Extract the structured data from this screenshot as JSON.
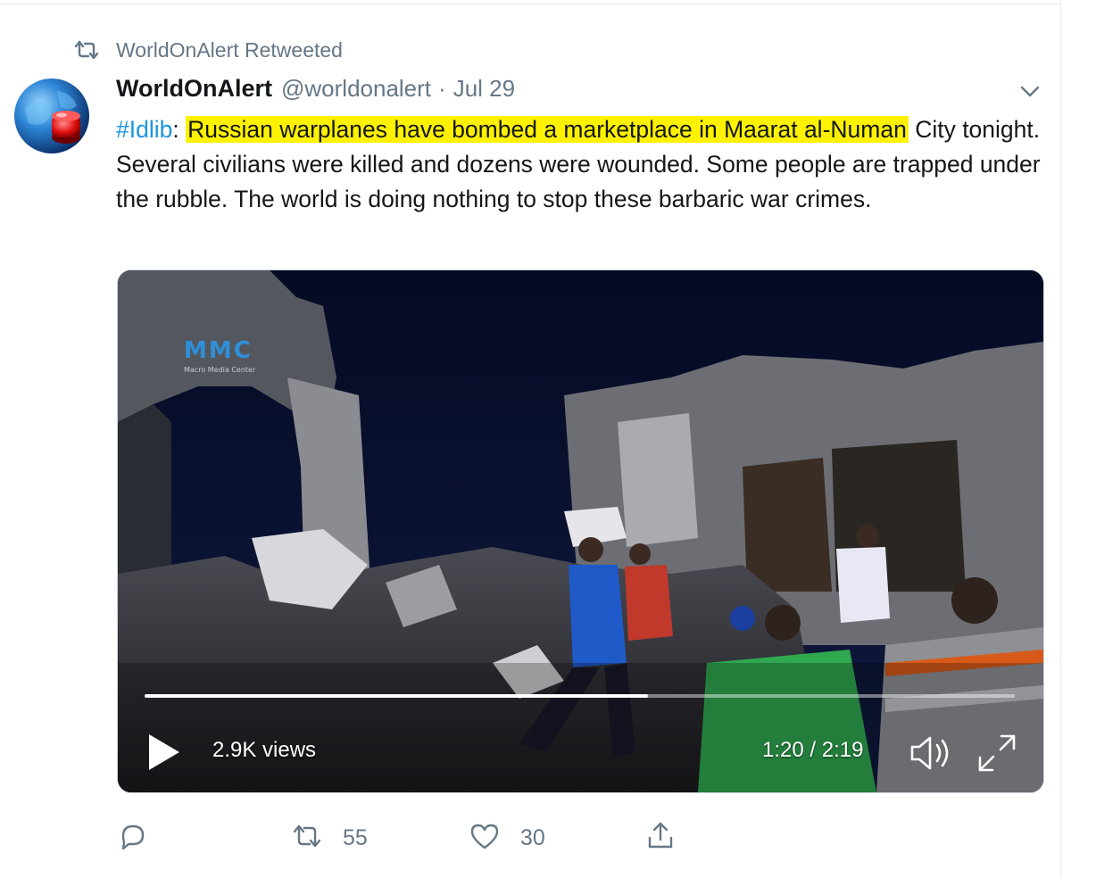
{
  "retweet_banner": {
    "text": "WorldOnAlert Retweeted"
  },
  "tweet": {
    "author_name": "WorldOnAlert",
    "handle": "@worldonalert",
    "separator": "·",
    "date": "Jul 29",
    "hashtag": "#Idlib",
    "colon": ":",
    "highlighted_text": "Russian warplanes have bombed a marketplace in Maarat al-Numan",
    "body_text": " City tonight. Several civilians were killed and dozens were wounded. Some people are trapped under the rubble. The world is doing nothing to stop these barbaric war crimes."
  },
  "video": {
    "views": "2.9K views",
    "time": "1:20 / 2:19",
    "progress_fraction": 0.578,
    "logo_text": "MMC",
    "logo_subtitle": "Macro Media Center"
  },
  "actions": {
    "reply_count": "",
    "retweet_count": "55",
    "like_count": "30"
  },
  "colors": {
    "link": "#1b95e0",
    "highlight": "#fff200",
    "muted": "#657786",
    "text": "#14171a"
  },
  "icons": [
    "retweet-icon",
    "avatar-globe-icon",
    "caret-down-icon",
    "play-icon",
    "volume-icon",
    "fullscreen-icon",
    "reply-icon",
    "like-icon",
    "share-icon"
  ]
}
